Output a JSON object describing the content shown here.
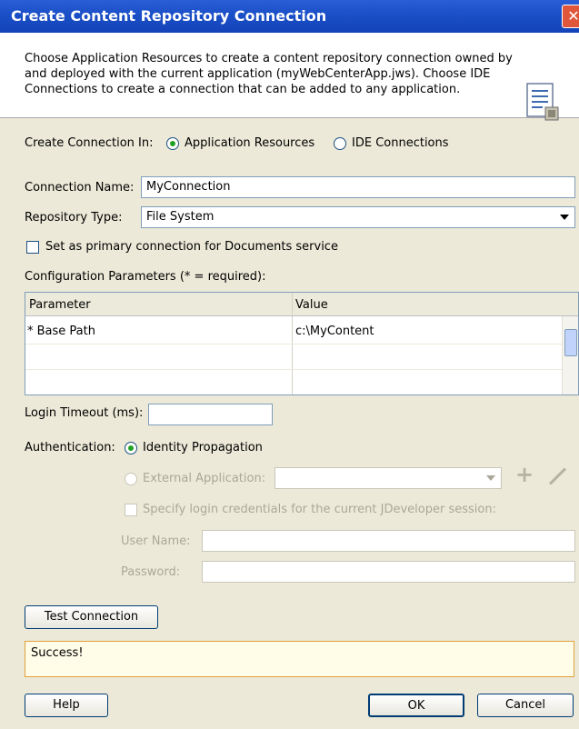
{
  "window": {
    "title": "Create Content Repository Connection"
  },
  "header": {
    "description": "Choose Application Resources to create a content repository connection owned by and deployed with the current application (myWebCenterApp.jws). Choose IDE Connections to create a connection that can be added to any application."
  },
  "create_in": {
    "label": "Create Connection In:",
    "option_app": "Application Resources",
    "option_ide": "IDE Connections",
    "selected": "Application Resources"
  },
  "connection_name": {
    "label": "Connection Name:",
    "value": "MyConnection"
  },
  "repository_type": {
    "label": "Repository Type:",
    "value": "File System"
  },
  "primary_connection": {
    "label": "Set as primary connection for Documents service",
    "checked": false
  },
  "config": {
    "label": "Configuration Parameters (* = required):",
    "columns": [
      "Parameter",
      "Value"
    ],
    "rows": [
      {
        "parameter": "* Base Path",
        "value": "c:\\MyContent"
      }
    ]
  },
  "login_timeout": {
    "label": "Login Timeout (ms):",
    "value": ""
  },
  "authentication": {
    "label": "Authentication:",
    "identity_propagation": "Identity Propagation",
    "external_application": "External Application:",
    "external_app_value": "",
    "specify_credentials": "Specify login credentials for the current JDeveloper session:",
    "user_name_label": "User Name:",
    "user_name_value": "",
    "password_label": "Password:",
    "password_value": ""
  },
  "buttons": {
    "test_connection": "Test Connection",
    "help": "Help",
    "ok": "OK",
    "cancel": "Cancel"
  },
  "status_text": "Success!",
  "colors": {
    "title_bar": "#1a4fc7",
    "status_border": "#e0a13a",
    "radio_selected": "#21a121"
  }
}
